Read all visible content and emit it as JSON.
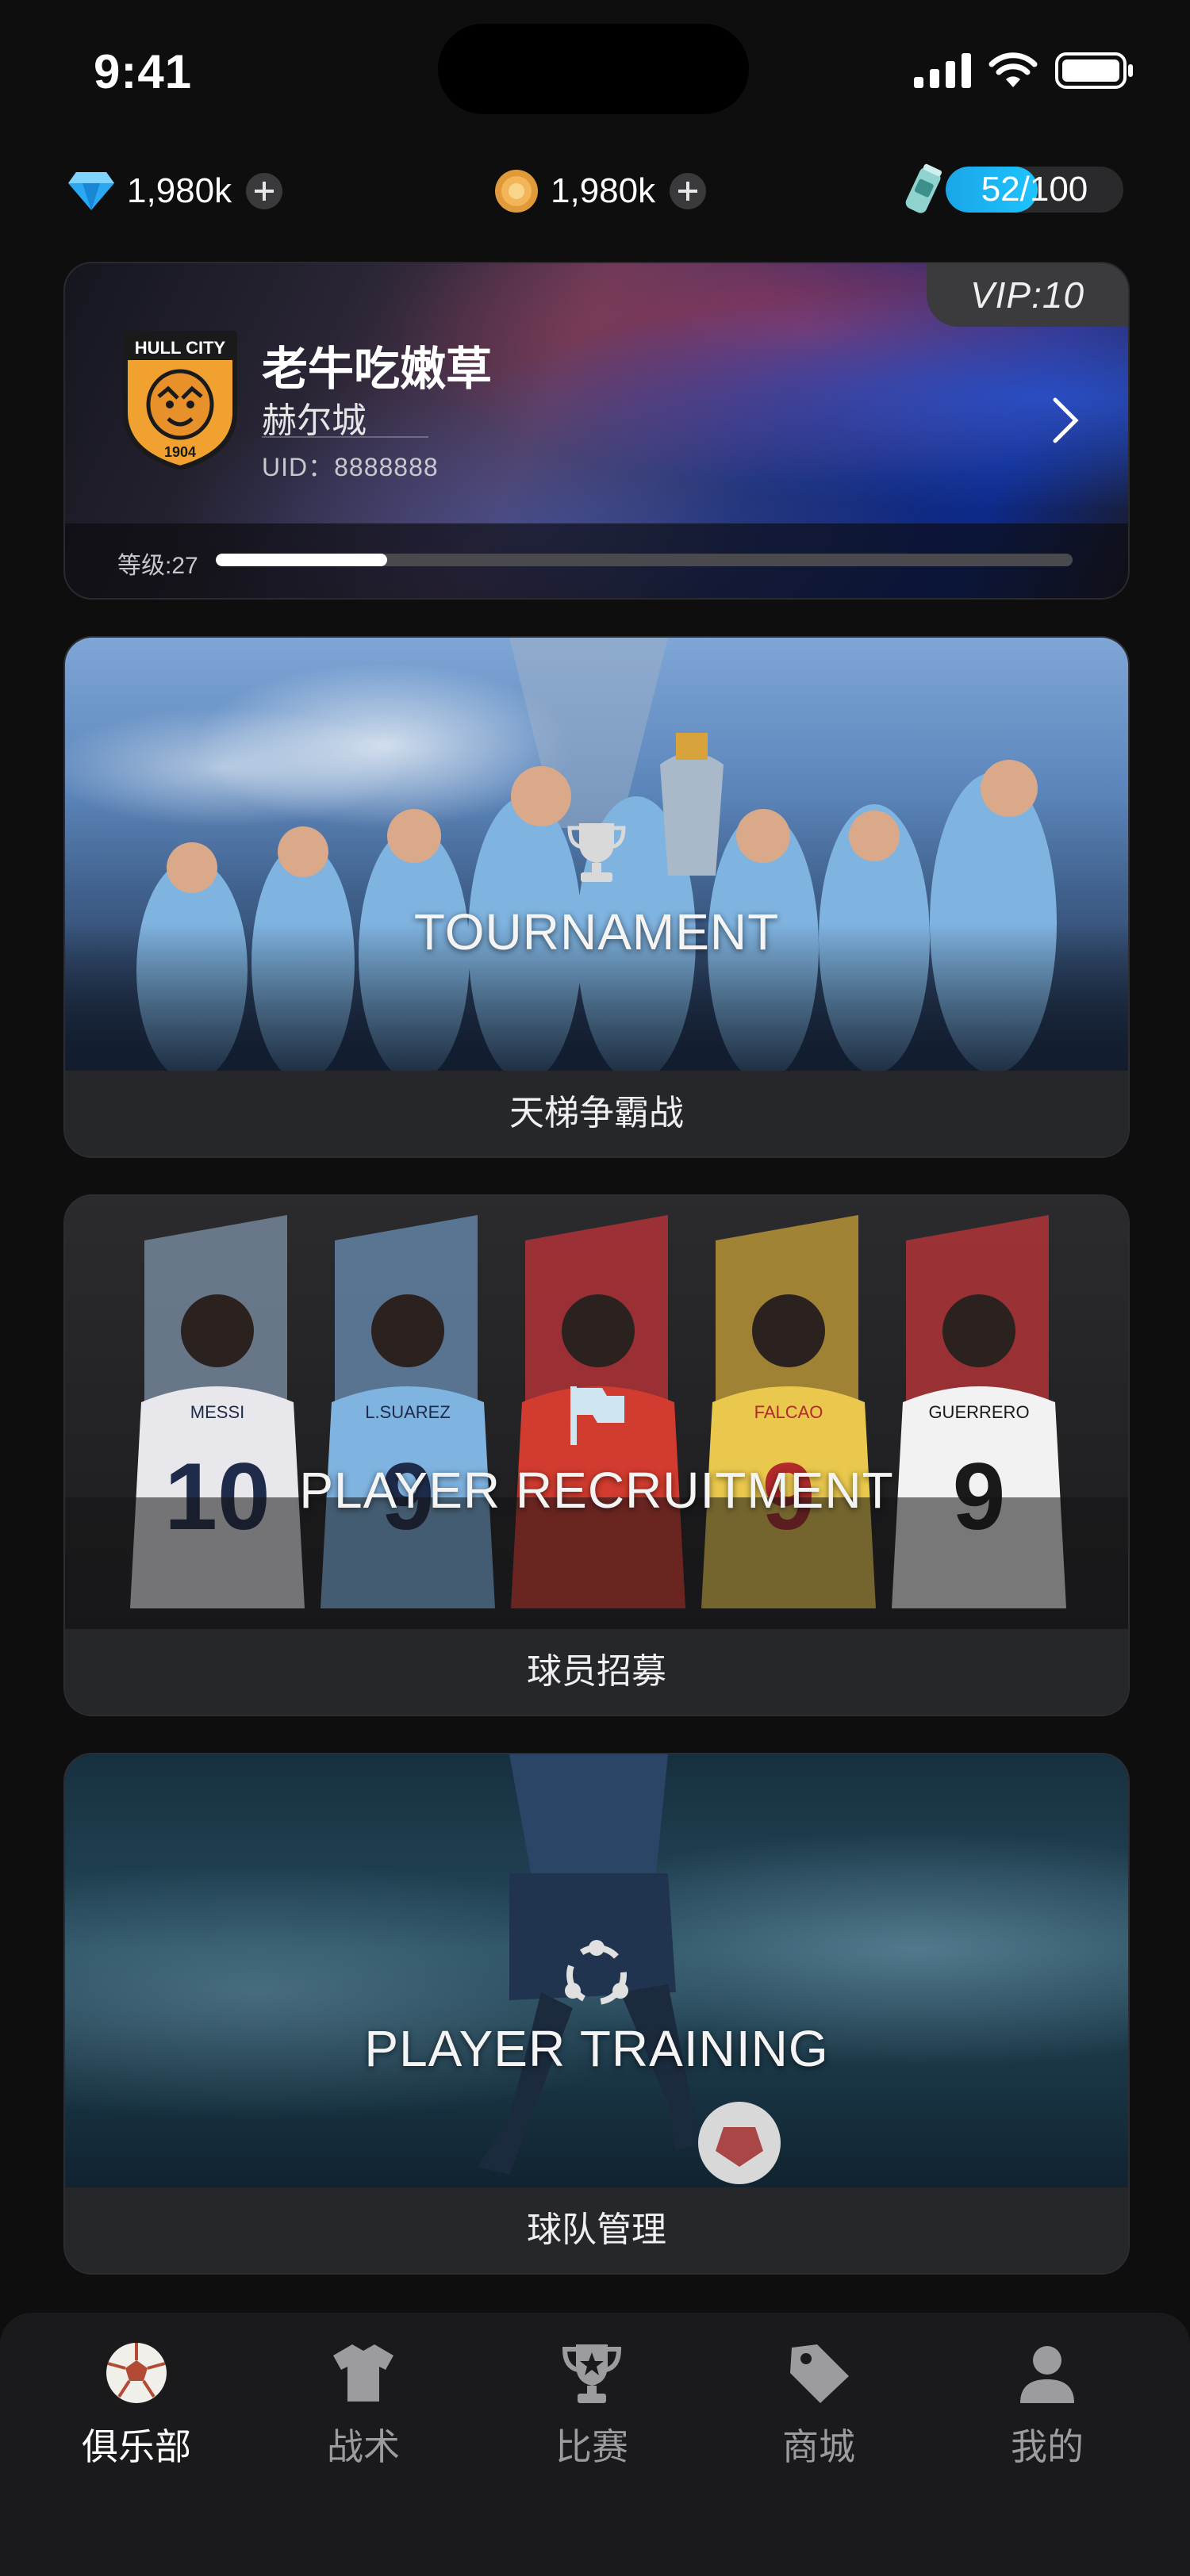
{
  "status_bar": {
    "time": "9:41"
  },
  "currencies": {
    "diamonds": {
      "value": "1,980k",
      "icon": "diamond-icon"
    },
    "coins": {
      "value": "1,980k",
      "icon": "coin-icon"
    },
    "energy": {
      "current": 52,
      "max": 100,
      "text": "52/100",
      "icon": "energy-drink-icon"
    }
  },
  "profile": {
    "vip": "VIP:10",
    "nickname": "老牛吃嫩草",
    "city": "赫尔城",
    "uid": "UID：8888888",
    "level_label": "等级:27",
    "level_progress": 0.2,
    "crest": {
      "top_text": "HULL CITY",
      "year": "1904"
    }
  },
  "features": [
    {
      "title": "TOURNAMENT",
      "caption": "天梯争霸战",
      "icon": "trophy-icon"
    },
    {
      "title": "PLAYER RECRUITMENT",
      "caption": "球员招募",
      "icon": "flag-icon"
    },
    {
      "title": "PLAYER TRAINING",
      "caption": "球队管理",
      "icon": "training-icon"
    }
  ],
  "recruit_jerseys": [
    {
      "name": "MESSI",
      "number": "10"
    },
    {
      "name": "L.SUAREZ",
      "number": "9"
    },
    {
      "name": "",
      "number": ""
    },
    {
      "name": "FALCAO",
      "number": "9"
    },
    {
      "name": "GUERRERO",
      "number": "9"
    }
  ],
  "tabbar": [
    {
      "label": "俱乐部",
      "icon": "soccer-ball-icon",
      "active": true
    },
    {
      "label": "战术",
      "icon": "jersey-icon",
      "active": false
    },
    {
      "label": "比赛",
      "icon": "trophy-star-icon",
      "active": false
    },
    {
      "label": "商城",
      "icon": "price-tag-icon",
      "active": false
    },
    {
      "label": "我的",
      "icon": "user-icon",
      "active": false
    }
  ],
  "colors": {
    "accent": "#1ec3ff",
    "background": "#0e0e0f",
    "caption_bg": "#26272b"
  }
}
